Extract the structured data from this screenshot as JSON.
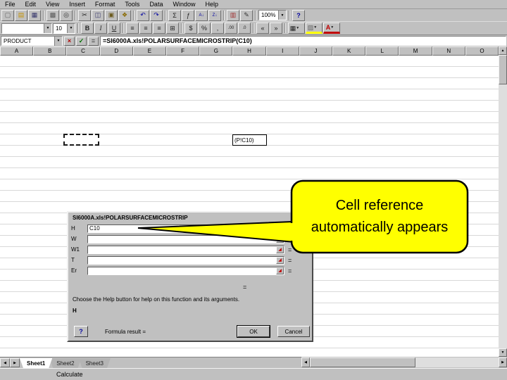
{
  "menu": {
    "items": [
      "File",
      "Edit",
      "View",
      "Insert",
      "Format",
      "Tools",
      "Data",
      "Window",
      "Help"
    ]
  },
  "standard_toolbar": {
    "zoom": "100%"
  },
  "formatting_toolbar": {
    "font_size": "10"
  },
  "formula_bar": {
    "name_box": "PRODUCT",
    "formula": "=SI6000A.xls!POLARSURFACEMICROSTRIP(C10)"
  },
  "grid": {
    "columns": [
      "A",
      "B",
      "C",
      "D",
      "E",
      "F",
      "G",
      "H",
      "I",
      "J",
      "K",
      "L",
      "M",
      "N",
      "O"
    ],
    "floating_cell_text": "(P!C10)"
  },
  "dialog": {
    "header": "SI6000A.xls!POLARSURFACEMICROSTRIP",
    "fields": [
      {
        "label": "H",
        "value": "C10"
      },
      {
        "label": "W",
        "value": ""
      },
      {
        "label": "W1",
        "value": ""
      },
      {
        "label": "T",
        "value": ""
      },
      {
        "label": "Er",
        "value": ""
      }
    ],
    "equals": "=",
    "help_text": "Choose the Help button for help on this function and its arguments.",
    "active_field": "H",
    "formula_result_label": "Formula result =",
    "buttons": {
      "ok": "OK",
      "cancel": "Cancel"
    }
  },
  "callout": {
    "line1": "Cell reference",
    "line2": "automatically appears",
    "color": "#ffff00"
  },
  "tabs": {
    "sheets": [
      "Sheet1",
      "Sheet2",
      "Sheet3"
    ],
    "active": "Sheet1"
  },
  "status": {
    "message": "Calculate"
  },
  "icons": {
    "new": "▢",
    "open": "▤",
    "save": "▦",
    "print": "▩",
    "preview": "◎",
    "cut": "✂",
    "copy": "◫",
    "paste": "▣",
    "format_painter": "❖",
    "undo": "↶",
    "redo": "↷",
    "autosum": "Σ",
    "function": "ƒ",
    "sort_asc": "A↓",
    "sort_desc": "Z↓",
    "chart": "▥",
    "drawing": "✎",
    "help": "?",
    "dropdown": "▼",
    "bold": "B",
    "italic": "I",
    "underline": "U",
    "align_left": "≡",
    "align_center": "≡",
    "align_right": "≡",
    "merge": "⊞",
    "currency": "$",
    "percent": "%",
    "comma": ",",
    "inc_decimal": ".00",
    "dec_decimal": ".0",
    "dec_indent": "«",
    "inc_indent": "»",
    "borders": "▦",
    "fill": "▨",
    "font_color": "A",
    "cancel_x": "×",
    "enter_check": "✓",
    "equals": "=",
    "collapse": "◢",
    "scroll_up": "▲",
    "scroll_down": "▼",
    "scroll_left": "◀",
    "scroll_right": "▶",
    "tab_prev": "◀",
    "tab_next": "▶",
    "help_balloon": "?"
  }
}
